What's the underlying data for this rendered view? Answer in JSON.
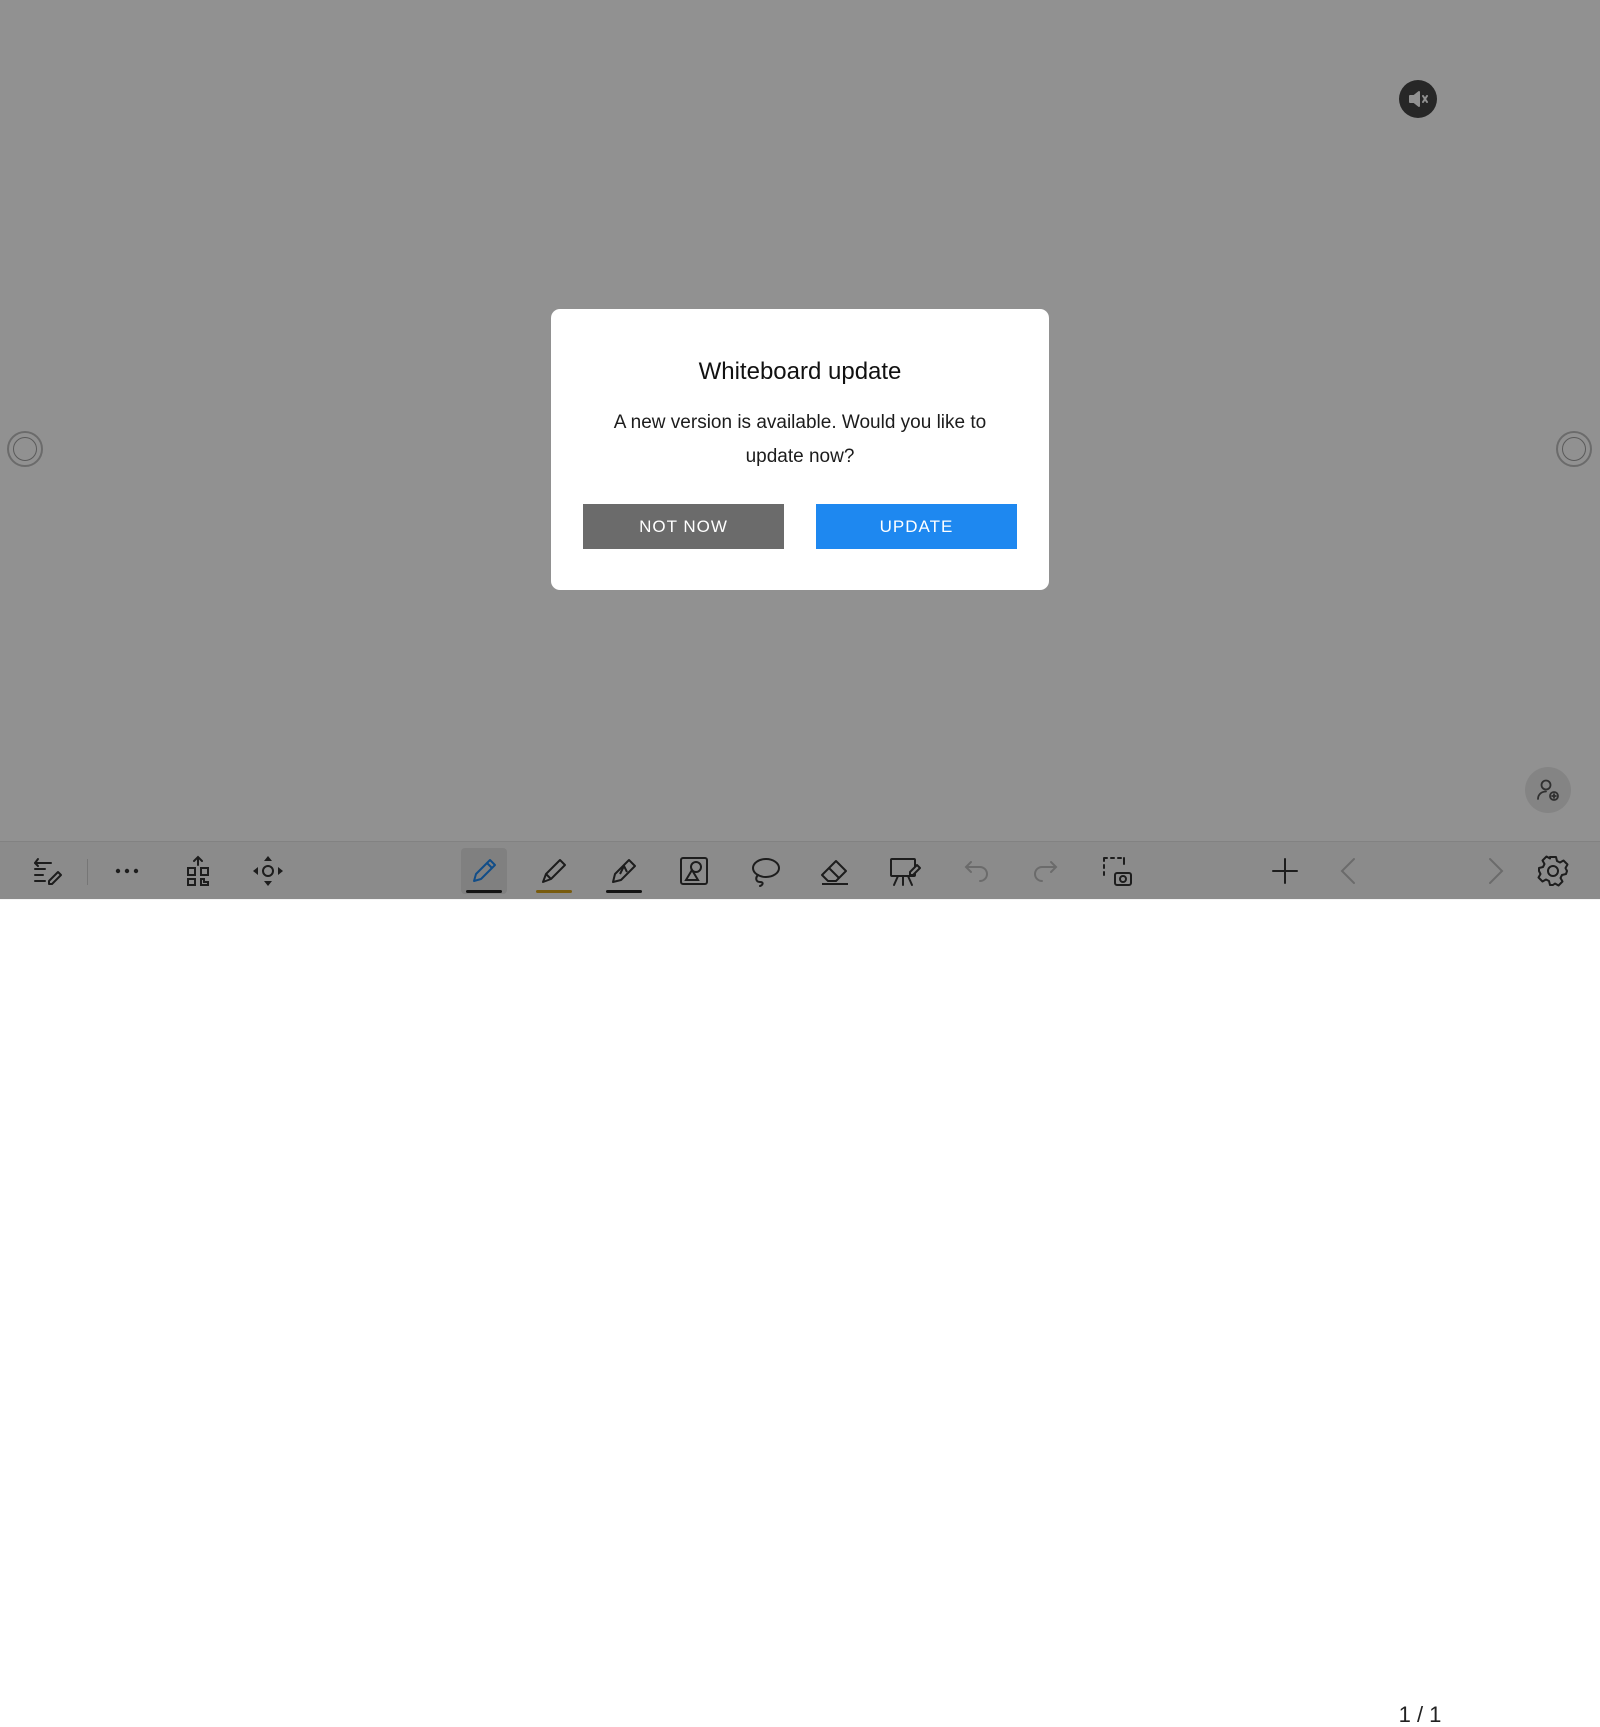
{
  "app": {
    "title": "Whiteboard"
  },
  "dialog": {
    "title": "Whiteboard update",
    "message": "A new version is available. Would you like to update now?",
    "buttons": {
      "not_now": "NOT NOW",
      "update": "UPDATE"
    }
  },
  "toolbar": {
    "left_tools": [
      {
        "name": "edit-notes-icon"
      },
      {
        "name": "more-icon"
      },
      {
        "name": "qr-share-icon"
      },
      {
        "name": "move-canvas-icon"
      }
    ],
    "center_tools": [
      {
        "name": "pen-icon",
        "active": true,
        "underline_color": "#222222"
      },
      {
        "name": "highlighter-icon",
        "underline_color": "#d4a017"
      },
      {
        "name": "smart-pen-icon",
        "underline_color": "#222222"
      },
      {
        "name": "shape-recognition-icon"
      },
      {
        "name": "lasso-icon"
      },
      {
        "name": "eraser-icon"
      },
      {
        "name": "presentation-icon"
      },
      {
        "name": "undo-icon",
        "disabled": true
      },
      {
        "name": "redo-icon",
        "disabled": true
      },
      {
        "name": "screenshot-icon"
      }
    ],
    "right_tools": [
      {
        "name": "add-page-icon"
      },
      {
        "name": "prev-page-icon",
        "disabled": true
      },
      {
        "name": "next-page-icon",
        "disabled": true
      },
      {
        "name": "settings-icon"
      }
    ],
    "page_indicator": "1 / 1"
  },
  "colors": {
    "primary": "#1e88f0",
    "secondary_button": "#6b6b6b",
    "pen_underline": "#222222",
    "highlighter_underline": "#d4a017"
  }
}
